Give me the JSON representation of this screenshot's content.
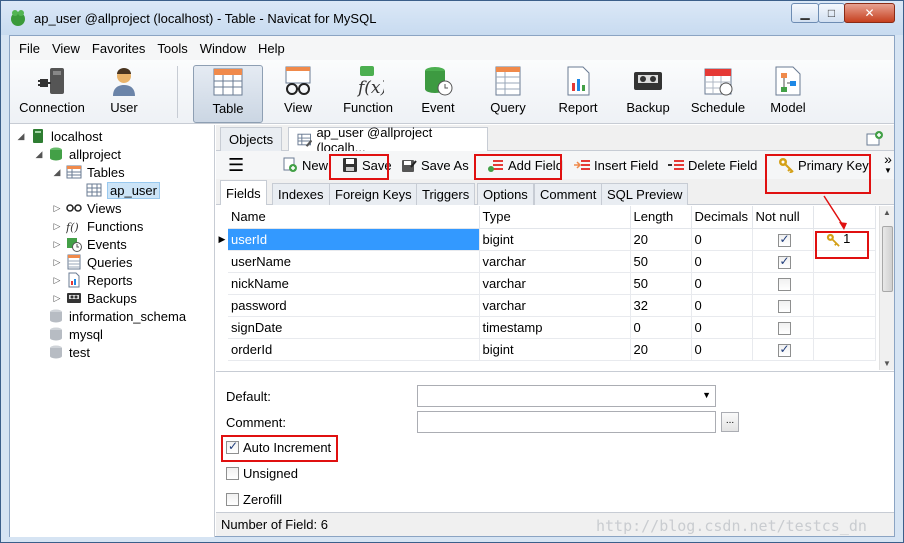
{
  "window": {
    "title": "ap_user @allproject (localhost) - Table - Navicat for MySQL"
  },
  "menu": [
    "File",
    "View",
    "Favorites",
    "Tools",
    "Window",
    "Help"
  ],
  "ribbon": {
    "items": [
      {
        "label": "Connection",
        "icon": "plug-icon"
      },
      {
        "label": "User",
        "icon": "user-icon"
      },
      {
        "label": "Table",
        "icon": "table-icon",
        "active": true
      },
      {
        "label": "View",
        "icon": "glasses-icon"
      },
      {
        "label": "Function",
        "icon": "function-icon"
      },
      {
        "label": "Event",
        "icon": "event-clock-icon"
      },
      {
        "label": "Query",
        "icon": "query-icon"
      },
      {
        "label": "Report",
        "icon": "report-icon"
      },
      {
        "label": "Backup",
        "icon": "tape-icon"
      },
      {
        "label": "Schedule",
        "icon": "calendar-icon"
      },
      {
        "label": "Model",
        "icon": "model-icon"
      }
    ]
  },
  "tree": {
    "items": [
      {
        "label": "localhost",
        "icon": "server-icon"
      },
      {
        "label": "allproject",
        "icon": "database-icon"
      },
      {
        "label": "Tables",
        "icon": "tables-icon"
      },
      {
        "label": "ap_user",
        "icon": "table-icon"
      },
      {
        "label": "Views",
        "icon": "glasses-icon"
      },
      {
        "label": "Functions",
        "icon": "function-icon"
      },
      {
        "label": "Events",
        "icon": "event-icon"
      },
      {
        "label": "Queries",
        "icon": "query-icon"
      },
      {
        "label": "Reports",
        "icon": "report-icon"
      },
      {
        "label": "Backups",
        "icon": "tape-icon"
      },
      {
        "label": "information_schema",
        "icon": "database-grey-icon"
      },
      {
        "label": "mysql",
        "icon": "database-grey-icon"
      },
      {
        "label": "test",
        "icon": "database-grey-icon"
      }
    ]
  },
  "tabs": {
    "objects": "Objects",
    "editor": "ap_user @allproject (localh..."
  },
  "toolbar": {
    "new": "New",
    "save": "Save",
    "save_as": "Save As",
    "add_field": "Add Field",
    "insert_field": "Insert Field",
    "delete_field": "Delete Field",
    "primary_key": "Primary Key",
    "overflow": "»"
  },
  "subtabs": [
    "Fields",
    "Indexes",
    "Foreign Keys",
    "Triggers",
    "Options",
    "Comment",
    "SQL Preview"
  ],
  "grid": {
    "headers": [
      "Name",
      "Type",
      "Length",
      "Decimals",
      "Not null",
      ""
    ],
    "rows": [
      {
        "name": "userId",
        "type": "bigint",
        "length": "20",
        "decimals": "0",
        "notnull": true,
        "key": "1"
      },
      {
        "name": "userName",
        "type": "varchar",
        "length": "50",
        "decimals": "0",
        "notnull": true,
        "key": ""
      },
      {
        "name": "nickName",
        "type": "varchar",
        "length": "50",
        "decimals": "0",
        "notnull": false,
        "key": ""
      },
      {
        "name": "password",
        "type": "varchar",
        "length": "32",
        "decimals": "0",
        "notnull": false,
        "key": ""
      },
      {
        "name": "signDate",
        "type": "timestamp",
        "length": "0",
        "decimals": "0",
        "notnull": false,
        "key": ""
      },
      {
        "name": "orderId",
        "type": "bigint",
        "length": "20",
        "decimals": "0",
        "notnull": true,
        "key": ""
      }
    ]
  },
  "properties": {
    "default_label": "Default:",
    "comment_label": "Comment:",
    "ellipsis": "...",
    "auto_increment": {
      "label": "Auto Increment",
      "checked": true
    },
    "unsigned": {
      "label": "Unsigned",
      "checked": false
    },
    "zerofill": {
      "label": "Zerofill",
      "checked": false
    }
  },
  "status": {
    "text": "Number of Field: 6"
  },
  "watermark": "http://blog.csdn.net/testcs_dn",
  "colors": {
    "highlight": "#e01010",
    "selection": "#3399ff",
    "key": "#d4a017"
  }
}
